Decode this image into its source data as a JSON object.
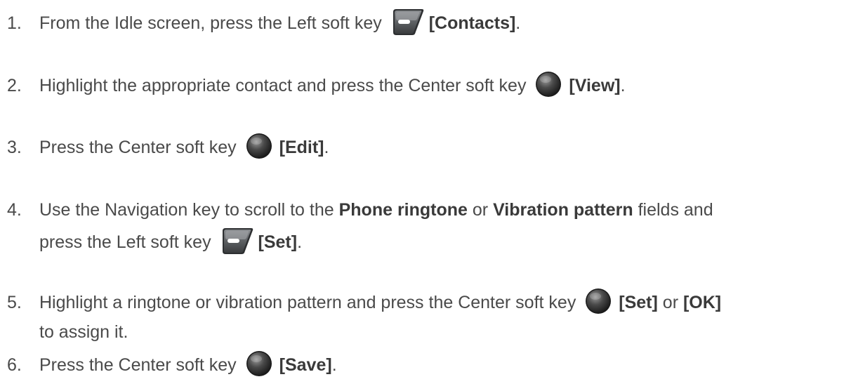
{
  "steps": [
    {
      "num": "1.",
      "pre": "From the Idle screen, press the Left soft key",
      "key_icon": "left-soft-key-icon",
      "action": "[Contacts]",
      "post": "."
    },
    {
      "num": "2.",
      "pre": "Highlight the appropriate contact and press the Center soft key",
      "key_icon": "center-soft-key-icon",
      "action": "[View]",
      "post": "."
    },
    {
      "num": "3.",
      "pre": "Press the Center soft key",
      "key_icon": "center-soft-key-icon",
      "action": "[Edit]",
      "post": "."
    },
    {
      "num": "4.",
      "pre1": "Use the Navigation key to scroll to the",
      "bold1": "Phone ringtone",
      "mid": "or",
      "bold2": "Vibration pattern",
      "post1": "fields and",
      "pre2": "press the Left soft key",
      "key_icon": "left-soft-key-icon",
      "action": "[Set]",
      "post": "."
    },
    {
      "num": "5.",
      "pre": "Highlight a ringtone or vibration pattern and press the Center soft key",
      "key_icon": "center-soft-key-icon",
      "action": "[Set]",
      "mid": "or",
      "action2": "[OK]",
      "line2": "to assign it."
    },
    {
      "num": "6.",
      "pre": "Press the Center soft key",
      "key_icon": "center-soft-key-icon",
      "action": "[Save]",
      "post": "."
    }
  ]
}
